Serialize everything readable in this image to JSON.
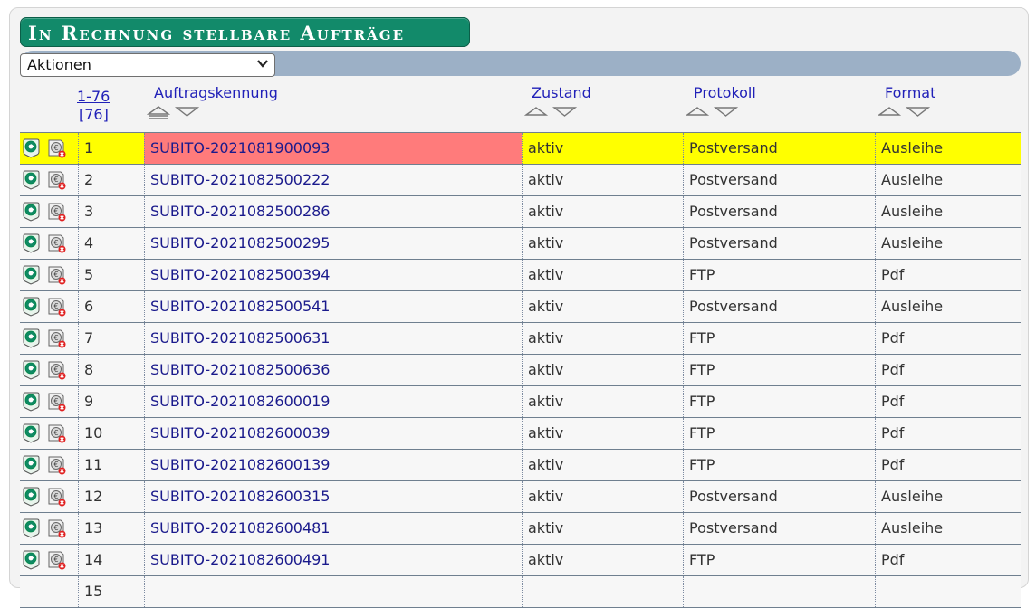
{
  "title": "In Rechnung stellbare Aufträge",
  "actions_select": {
    "selected": "Aktionen"
  },
  "header": {
    "range_link": "1-76",
    "total": "[76]",
    "col_id": "Auftragskennung",
    "col_state": "Zustand",
    "col_protocol": "Protokoll",
    "col_format": "Format"
  },
  "icons": {
    "action_a": "open-order-icon",
    "action_b": "cancel-order-icon"
  },
  "colors": {
    "selected_row": "#ffff00",
    "selected_id_cell": "#ff7b7b",
    "title_bg": "#128a6a",
    "toolbar_bg": "#9cb0c6"
  },
  "rows": [
    {
      "num": "1",
      "id": "SUBITO-2021081900093",
      "state": "aktiv",
      "protocol": "Postversand",
      "format": "Ausleihe"
    },
    {
      "num": "2",
      "id": "SUBITO-2021082500222",
      "state": "aktiv",
      "protocol": "Postversand",
      "format": "Ausleihe"
    },
    {
      "num": "3",
      "id": "SUBITO-2021082500286",
      "state": "aktiv",
      "protocol": "Postversand",
      "format": "Ausleihe"
    },
    {
      "num": "4",
      "id": "SUBITO-2021082500295",
      "state": "aktiv",
      "protocol": "Postversand",
      "format": "Ausleihe"
    },
    {
      "num": "5",
      "id": "SUBITO-2021082500394",
      "state": "aktiv",
      "protocol": "FTP",
      "format": "Pdf"
    },
    {
      "num": "6",
      "id": "SUBITO-2021082500541",
      "state": "aktiv",
      "protocol": "Postversand",
      "format": "Ausleihe"
    },
    {
      "num": "7",
      "id": "SUBITO-2021082500631",
      "state": "aktiv",
      "protocol": "FTP",
      "format": "Pdf"
    },
    {
      "num": "8",
      "id": "SUBITO-2021082500636",
      "state": "aktiv",
      "protocol": "FTP",
      "format": "Pdf"
    },
    {
      "num": "9",
      "id": "SUBITO-2021082600019",
      "state": "aktiv",
      "protocol": "FTP",
      "format": "Pdf"
    },
    {
      "num": "10",
      "id": "SUBITO-2021082600039",
      "state": "aktiv",
      "protocol": "FTP",
      "format": "Pdf"
    },
    {
      "num": "11",
      "id": "SUBITO-2021082600139",
      "state": "aktiv",
      "protocol": "FTP",
      "format": "Pdf"
    },
    {
      "num": "12",
      "id": "SUBITO-2021082600315",
      "state": "aktiv",
      "protocol": "Postversand",
      "format": "Ausleihe"
    },
    {
      "num": "13",
      "id": "SUBITO-2021082600481",
      "state": "aktiv",
      "protocol": "Postversand",
      "format": "Ausleihe"
    },
    {
      "num": "14",
      "id": "SUBITO-2021082600491",
      "state": "aktiv",
      "protocol": "FTP",
      "format": "Pdf"
    },
    {
      "num": "15",
      "id": "",
      "state": "",
      "protocol": "",
      "format": ""
    }
  ]
}
